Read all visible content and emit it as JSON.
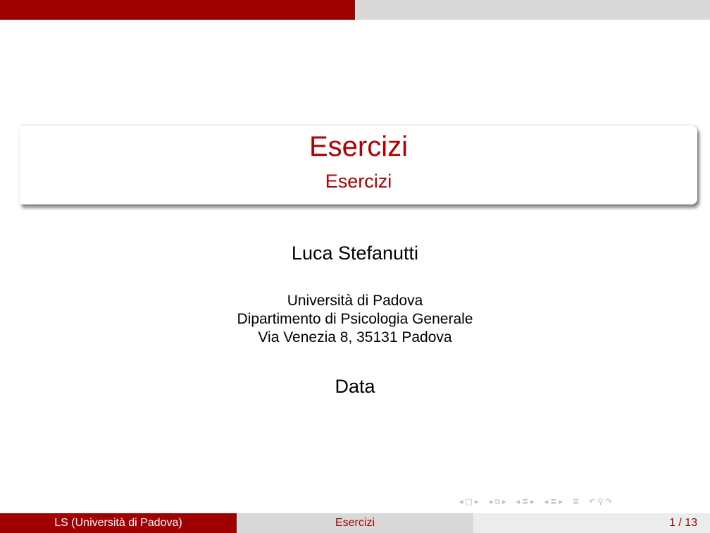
{
  "slide": {
    "title": "Esercizi",
    "subtitle": "Esercizi",
    "author": "Luca Stefanutti",
    "institute_lines": [
      "Università di Padova",
      "Dipartimento di Psicologia Generale",
      "Via Venezia 8, 35131 Padova"
    ],
    "date": "Data"
  },
  "progress": {
    "current_page": 1,
    "total_pages": 13,
    "fill_fraction": 0.5
  },
  "footer": {
    "left": "LS  (Università di Padova)",
    "center": "Esercizi",
    "right": "1 / 13"
  },
  "navigation": {
    "icons": [
      "arrow-left-icon",
      "frame-icon",
      "arrow-right-icon",
      "arrow-left-icon",
      "subsection-icon",
      "arrow-right-icon",
      "arrow-left-icon",
      "section-icon",
      "arrow-right-icon",
      "arrow-left-icon",
      "section-icon",
      "arrow-right-icon",
      "appendix-icon",
      "back-icon",
      "find-icon",
      "forward-icon"
    ]
  },
  "colors": {
    "accent": "#a00000",
    "title": "#b30000",
    "progress_track": "#d9d9d9",
    "nav_icons": "#b9b9c8"
  }
}
